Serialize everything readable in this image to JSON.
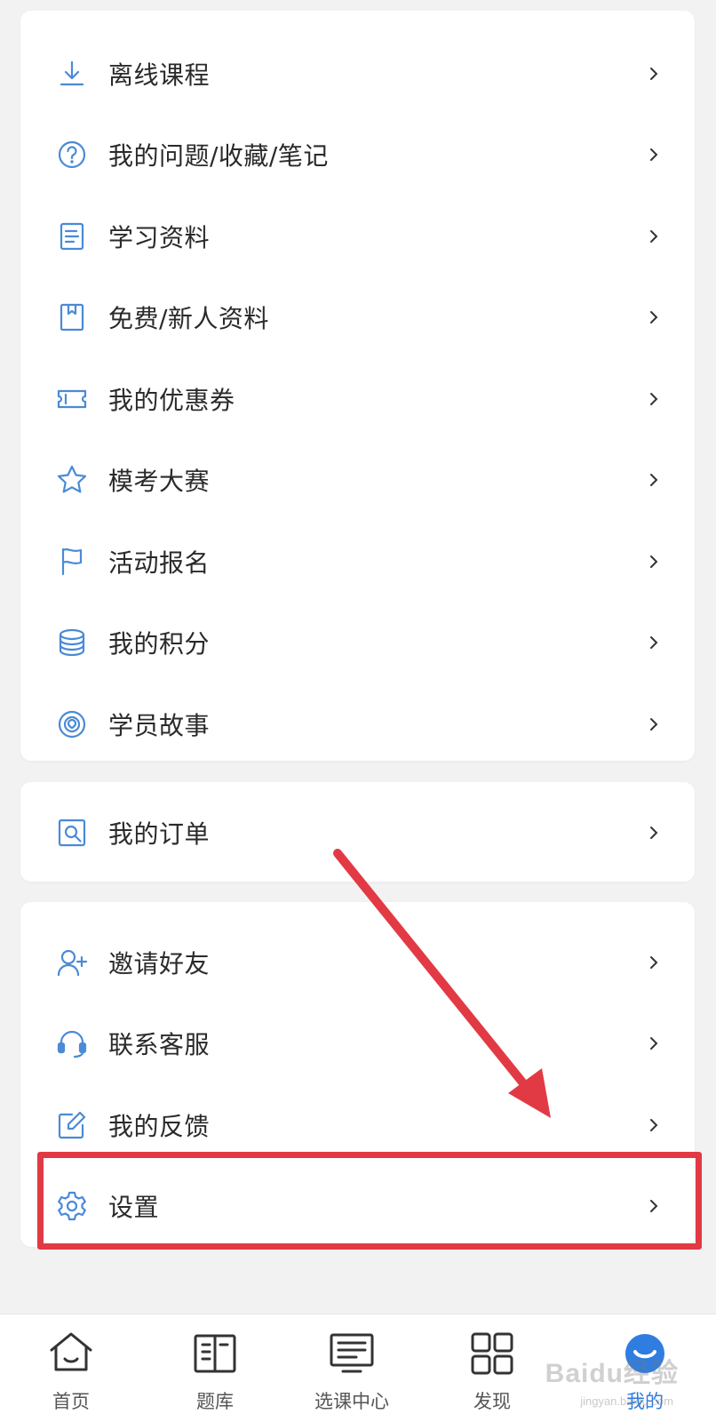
{
  "colors": {
    "icon_blue": "#4a8ad6",
    "accent": "#2f7de1",
    "highlight_red": "#e23a45"
  },
  "menu_group_1": [
    {
      "label": "离线课程",
      "icon": "download-icon"
    },
    {
      "label": "我的问题/收藏/笔记",
      "icon": "question-icon"
    },
    {
      "label": "学习资料",
      "icon": "document-icon"
    },
    {
      "label": "免费/新人资料",
      "icon": "bookmark-book-icon"
    },
    {
      "label": "我的优惠券",
      "icon": "ticket-icon"
    },
    {
      "label": "模考大赛",
      "icon": "star-icon"
    },
    {
      "label": "活动报名",
      "icon": "flag-icon"
    },
    {
      "label": "我的积分",
      "icon": "coins-icon"
    },
    {
      "label": "学员故事",
      "icon": "story-icon"
    }
  ],
  "menu_group_2": [
    {
      "label": "我的订单",
      "icon": "order-search-icon"
    }
  ],
  "menu_group_3": [
    {
      "label": "邀请好友",
      "icon": "add-user-icon"
    },
    {
      "label": "联系客服",
      "icon": "headset-icon"
    },
    {
      "label": "我的反馈",
      "icon": "edit-icon"
    },
    {
      "label": "设置",
      "icon": "gear-icon"
    }
  ],
  "chevron": ">",
  "bottom_nav": [
    {
      "label": "首页",
      "icon": "home-icon"
    },
    {
      "label": "题库",
      "icon": "book-icon"
    },
    {
      "label": "选课中心",
      "icon": "monitor-icon"
    },
    {
      "label": "发现",
      "icon": "grid-icon"
    },
    {
      "label": "我的",
      "icon": "profile-icon",
      "active": true
    }
  ],
  "watermark": {
    "text": "Baidu经验",
    "sub": "jingyan.baidu.com"
  }
}
